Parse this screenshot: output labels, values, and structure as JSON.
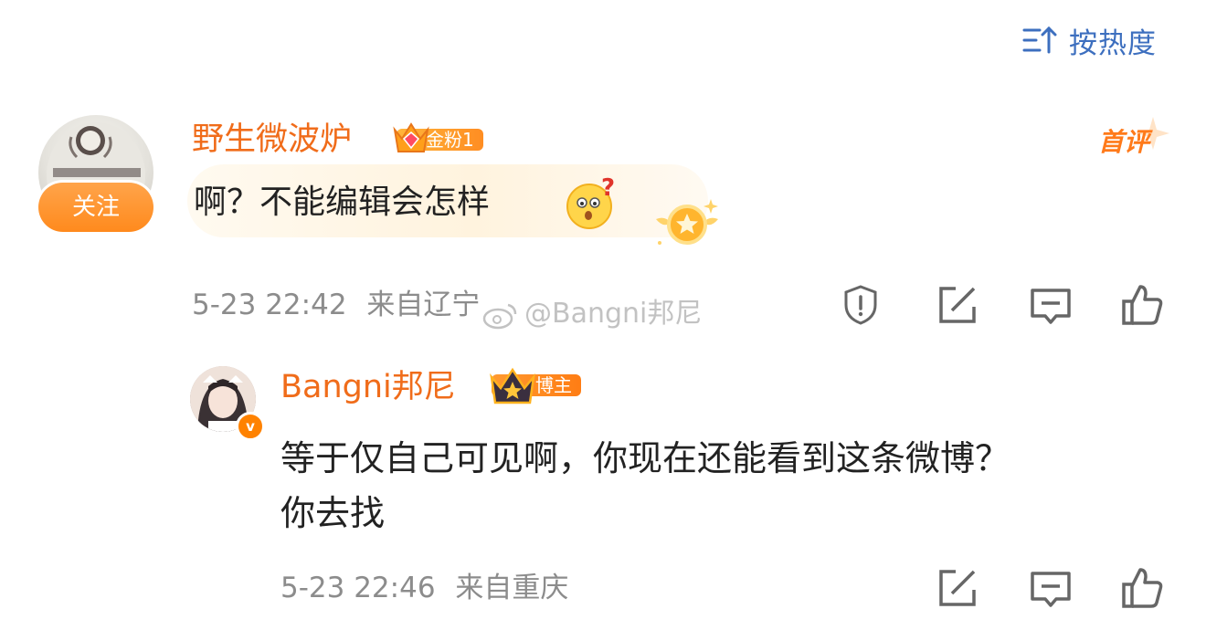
{
  "sort": {
    "label": "按热度",
    "icon": "sort-icon"
  },
  "comment": {
    "user": "野生微波炉",
    "follow_label": "关注",
    "fan_badge": "金粉1",
    "first_flag": "首评",
    "text": "啊？不能编辑会怎样",
    "time": "5-23 22:42",
    "location": "来自辽宁",
    "watermark": "@Bangni邦尼"
  },
  "reply": {
    "user": "Bangni邦尼",
    "host_badge": "博主",
    "verified_mark": "v",
    "text_line1": "等于仅自己可见啊，你现在还能看到这条微博？",
    "text_line2": "你去找",
    "time": "5-23 22:46",
    "location": "来自重庆"
  },
  "colors": {
    "accent": "#f06c1a",
    "link_blue": "#3d6fbf",
    "meta_gray": "#8c8c8c"
  }
}
